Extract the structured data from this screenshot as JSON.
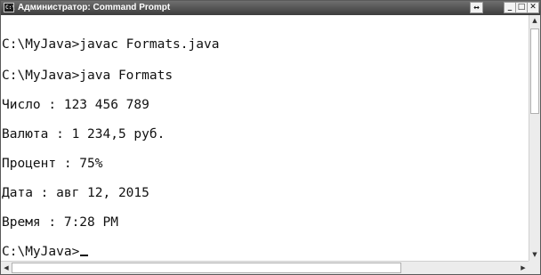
{
  "window": {
    "title": "Администратор: Command Prompt",
    "icon_name": "console-icon"
  },
  "titlebar_buttons": {
    "resize_icon": "↔",
    "minimize_icon": "_",
    "maximize_icon": "□",
    "close_icon": "✕"
  },
  "console": {
    "lines": [
      "C:\\MyJava>javac Formats.java",
      "C:\\MyJava>java Formats",
      "Число : 123 456 789",
      "Валюта : 1 234,5 руб.",
      "Процент : 75%",
      "Дата : авг 12, 2015",
      "Время : 7:28 PM",
      "C:\\MyJava>"
    ]
  },
  "scrollbars": {
    "up_arrow": "▲",
    "down_arrow": "▼",
    "left_arrow": "◀",
    "right_arrow": "▶"
  }
}
